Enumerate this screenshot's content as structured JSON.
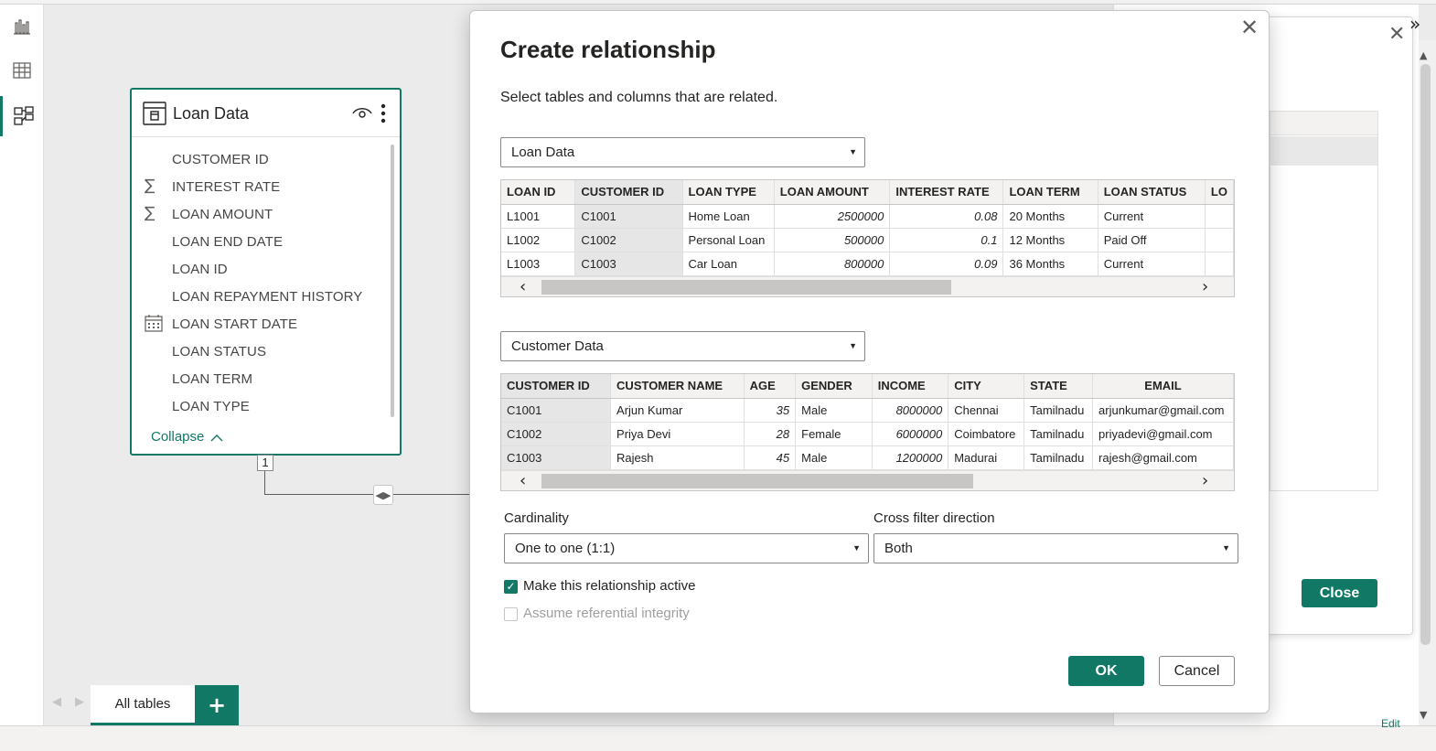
{
  "left_rail": {
    "icons": [
      "report-view-icon",
      "table-view-icon",
      "model-view-icon"
    ]
  },
  "card": {
    "title": "Loan Data",
    "fields": [
      {
        "label": "CUSTOMER ID",
        "icon": ""
      },
      {
        "label": "INTEREST RATE",
        "icon": "sigma"
      },
      {
        "label": "LOAN AMOUNT",
        "icon": "sigma"
      },
      {
        "label": "LOAN END DATE",
        "icon": ""
      },
      {
        "label": "LOAN ID",
        "icon": ""
      },
      {
        "label": "LOAN REPAYMENT HISTORY",
        "icon": ""
      },
      {
        "label": "LOAN START DATE",
        "icon": "calendar"
      },
      {
        "label": "LOAN STATUS",
        "icon": ""
      },
      {
        "label": "LOAN TERM",
        "icon": ""
      },
      {
        "label": "LOAN TYPE",
        "icon": ""
      }
    ],
    "collapse_label": "Collapse",
    "cardinality_marker": "1"
  },
  "tabs": {
    "all_tables": "All tables",
    "add": "+"
  },
  "background_panel": {
    "close_button": "Close",
    "edit_link": "Edit"
  },
  "dialog": {
    "title": "Create relationship",
    "subtitle": "Select tables and columns that are related.",
    "table1": {
      "selected": "Loan Data",
      "columns": [
        "LOAN ID",
        "CUSTOMER ID",
        "LOAN TYPE",
        "LOAN AMOUNT",
        "INTEREST RATE",
        "LOAN TERM",
        "LOAN STATUS",
        "LO"
      ],
      "rows": [
        [
          "L1001",
          "C1001",
          "Home Loan",
          "2500000",
          "0.08",
          "20 Months",
          "Current",
          ""
        ],
        [
          "L1002",
          "C1002",
          "Personal Loan",
          "500000",
          "0.1",
          "12 Months",
          "Paid Off",
          ""
        ],
        [
          "L1003",
          "C1003",
          "Car Loan",
          "800000",
          "0.09",
          "36 Months",
          "Current",
          ""
        ]
      ]
    },
    "table2": {
      "selected": "Customer Data",
      "columns": [
        "CUSTOMER ID",
        "CUSTOMER NAME",
        "AGE",
        "GENDER",
        "INCOME",
        "CITY",
        "STATE",
        "EMAIL"
      ],
      "rows": [
        [
          "C1001",
          "Arjun Kumar",
          "35",
          "Male",
          "8000000",
          "Chennai",
          "Tamilnadu",
          "arjunkumar@gmail.com"
        ],
        [
          "C1002",
          "Priya Devi",
          "28",
          "Female",
          "6000000",
          "Coimbatore",
          "Tamilnadu",
          "priyadevi@gmail.com"
        ],
        [
          "C1003",
          "Rajesh",
          "45",
          "Male",
          "1200000",
          "Madurai",
          "Tamilnadu",
          "rajesh@gmail.com"
        ]
      ]
    },
    "cardinality_label": "Cardinality",
    "cardinality_value": "One to one (1:1)",
    "cross_filter_label": "Cross filter direction",
    "cross_filter_value": "Both",
    "active_label": "Make this relationship active",
    "active_checked": true,
    "referential_label": "Assume referential integrity",
    "referential_checked": false,
    "ok_label": "OK",
    "cancel_label": "Cancel"
  },
  "colors": {
    "accent": "#117865"
  }
}
